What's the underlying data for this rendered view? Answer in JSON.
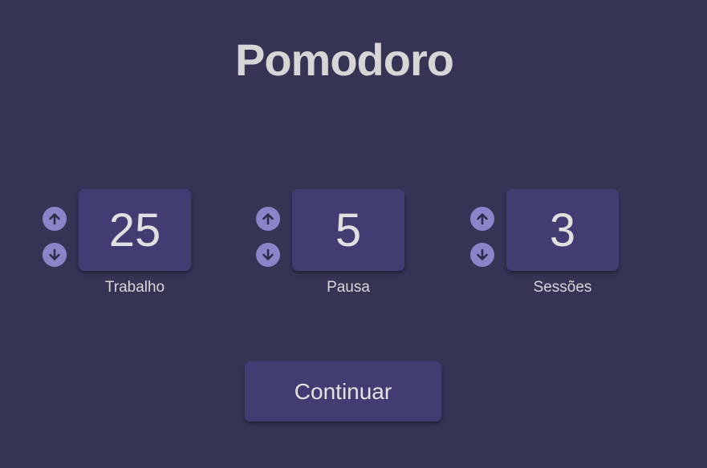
{
  "title": "Pomodoro",
  "settings": [
    {
      "label": "Trabalho",
      "value": "25",
      "up_icon": "arrow-up-circle-icon",
      "down_icon": "arrow-down-circle-icon"
    },
    {
      "label": "Pausa",
      "value": "5",
      "up_icon": "arrow-up-circle-icon",
      "down_icon": "arrow-down-circle-icon"
    },
    {
      "label": "Sessões",
      "value": "3",
      "up_icon": "arrow-up-circle-icon",
      "down_icon": "arrow-down-circle-icon"
    }
  ],
  "continue_label": "Continuar",
  "colors": {
    "background": "#353455",
    "panel": "#413d72",
    "accent": "#8a85c8",
    "text": "#d6d6d6"
  }
}
